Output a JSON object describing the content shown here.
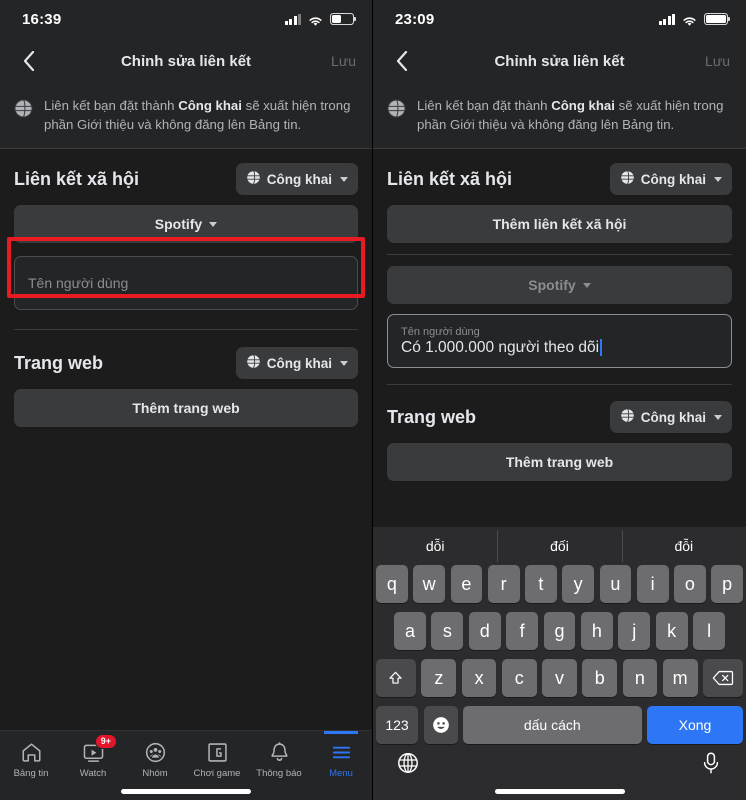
{
  "left": {
    "status": {
      "time": "16:39",
      "signal_icon": "cellular-signal-icon",
      "wifi_icon": "wifi-icon",
      "battery_icon": "battery-half-icon"
    },
    "nav": {
      "back_icon": "chevron-left-icon",
      "title": "Chỉnh sửa liên kết",
      "save_label": "Lưu"
    },
    "banner": {
      "icon": "globe-icon",
      "text_before": "Liên kết bạn đặt thành ",
      "text_bold": "Công khai",
      "text_after": " sẽ xuất hiện trong phần Giới thiệu và không đăng lên Bảng tin."
    },
    "social": {
      "title": "Liên kết xã hội",
      "privacy_label": "Công khai",
      "privacy_icon": "globe-icon",
      "provider_label": "Spotify",
      "username_placeholder": "Tên người dùng"
    },
    "website": {
      "title": "Trang web",
      "privacy_label": "Công khai",
      "privacy_icon": "globe-icon",
      "add_label": "Thêm trang web"
    },
    "tabbar": [
      {
        "label": "Bảng tin",
        "icon": "home-icon",
        "badge": "",
        "active": false
      },
      {
        "label": "Watch",
        "icon": "watch-video-icon",
        "badge": "9+",
        "active": false
      },
      {
        "label": "Nhóm",
        "icon": "groups-icon",
        "badge": "",
        "active": false
      },
      {
        "label": "Chơi game",
        "icon": "gaming-icon",
        "badge": "",
        "active": false
      },
      {
        "label": "Thông báo",
        "icon": "bell-icon",
        "badge": "",
        "active": false
      },
      {
        "label": "Menu",
        "icon": "hamburger-menu-icon",
        "badge": "",
        "active": true
      }
    ],
    "annotation": {
      "type": "red-highlight-box",
      "target": "username-input"
    }
  },
  "right": {
    "status": {
      "time": "23:09",
      "signal_icon": "cellular-signal-icon",
      "wifi_icon": "wifi-icon",
      "battery_icon": "battery-full-icon"
    },
    "nav": {
      "back_icon": "chevron-left-icon",
      "title": "Chỉnh sửa liên kết",
      "save_label": "Lưu"
    },
    "banner": {
      "icon": "globe-icon",
      "text_before": "Liên kết bạn đặt thành ",
      "text_bold": "Công khai",
      "text_after": " sẽ xuất hiện trong phần Giới thiệu và không đăng lên Bảng tin."
    },
    "social": {
      "title": "Liên kết xã hội",
      "privacy_label": "Công khai",
      "privacy_icon": "globe-icon",
      "add_social_label": "Thêm liên kết xã hội",
      "provider_label": "Spotify",
      "username_label": "Tên người dùng",
      "username_value": "Có 1.000.000 người theo dõi"
    },
    "website": {
      "title": "Trang web",
      "privacy_label": "Công khai",
      "privacy_icon": "globe-icon",
      "add_label": "Thêm trang web"
    },
    "keyboard": {
      "suggestions": [
        "dỗi",
        "đối",
        "đỗi"
      ],
      "row1": [
        "q",
        "w",
        "e",
        "r",
        "t",
        "y",
        "u",
        "i",
        "o",
        "p"
      ],
      "row2": [
        "a",
        "s",
        "d",
        "f",
        "g",
        "h",
        "j",
        "k",
        "l"
      ],
      "row3": [
        "z",
        "x",
        "c",
        "v",
        "b",
        "n",
        "m"
      ],
      "shift_icon": "shift-up-arrow-icon",
      "backspace_icon": "backspace-delete-icon",
      "numbers_label": "123",
      "emoji_icon": "emoji-smiley-icon",
      "space_label": "dấu cách",
      "done_label": "Xong",
      "globe_icon": "globe-keyboard-switch-icon",
      "mic_icon": "microphone-icon"
    }
  },
  "colors": {
    "accent_blue": "#2d76f5",
    "badge_red": "#e4142b",
    "annotation_red": "#e81b23",
    "surface": "#242526",
    "surface_alt": "#3a3b3c"
  }
}
